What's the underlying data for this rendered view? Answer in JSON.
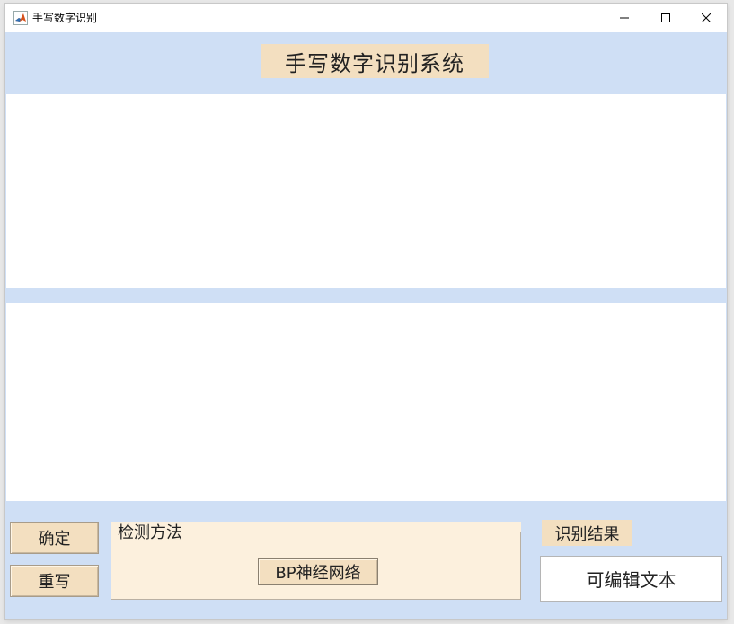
{
  "window": {
    "title": "手写数字识别",
    "icon": "matlab-logo-icon",
    "controls": [
      "minimize-icon",
      "maximize-icon",
      "close-icon"
    ]
  },
  "header": {
    "title": "手写数字识别系统"
  },
  "buttons": {
    "confirm_label": "确定",
    "rewrite_label": "重写"
  },
  "detection_panel": {
    "title": "检测方法",
    "method_button_label": "BP神经网络"
  },
  "result": {
    "label": "识别结果",
    "text_value": "可编辑文本"
  },
  "colors": {
    "background": "#cfdff5",
    "label_bg": "#f3dfc0",
    "panel_bg": "#fcf0dd"
  }
}
